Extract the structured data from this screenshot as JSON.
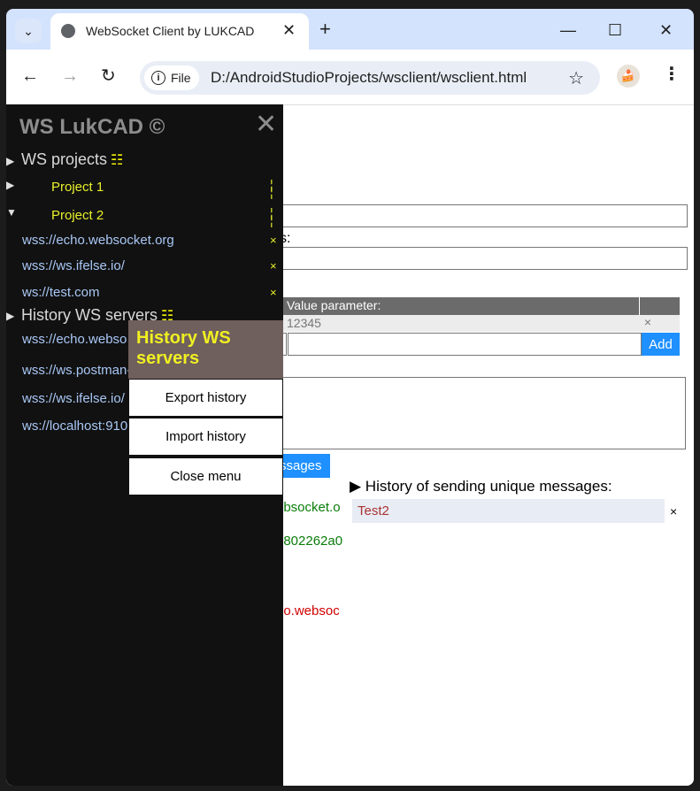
{
  "browser": {
    "tab_title": "WebSocket Client by LUKCAD",
    "tab_close": "✕",
    "new_tab": "+",
    "chip_label": "File",
    "url": "D:/AndroidStudioProjects/wsclient/wsclient.html",
    "window_controls": {
      "minimize": "—",
      "maximize": "☐",
      "close": "✕"
    },
    "nav": {
      "back": "←",
      "forward": "→",
      "reload": "↻"
    },
    "star": "☆",
    "menu": "⋮"
  },
  "sidebar": {
    "title": "WS LukCAD ©",
    "close": "✕",
    "projects_label": "WS projects",
    "projects": [
      {
        "name": "Project 1",
        "expanded": false
      },
      {
        "name": "Project 2",
        "expanded": true
      }
    ],
    "project2_links": [
      "wss://echo.websocket.org",
      "wss://ws.ifelse.io/",
      "ws://test.com"
    ],
    "history_label": "History WS servers",
    "history_links": [
      "wss://echo.webso",
      "wss://ws.postman-",
      "wss://ws.ifelse.io/",
      "ws://localhost:910"
    ],
    "link_remove": "×"
  },
  "context_menu": {
    "title": "History WS servers",
    "items": [
      "Export history",
      "Import history",
      "Close menu"
    ]
  },
  "page": {
    "params_label_suffix": "s:",
    "table_header": "Value parameter:",
    "table_value": "12345",
    "table_remove": "×",
    "add_button": "Add",
    "messages_button": "ssages",
    "history_summary": "History of sending unique messages:",
    "history_items": [
      "Test2"
    ],
    "history_remove": "×",
    "log_lines": [
      {
        "text": "ebsocket.o",
        "color": "#0a7d0a"
      },
      {
        "text": "3802262a0",
        "color": "#0a7d0a"
      },
      {
        "text": "ho.websoc",
        "color": "#d00000"
      }
    ]
  },
  "colors": {
    "accent_blue": "#1e90ff",
    "sidebar_bg": "#111111",
    "project_yellow": "#e8f02a",
    "link_blue": "#a9c7f5",
    "menu_header": "#6f5f5d"
  }
}
